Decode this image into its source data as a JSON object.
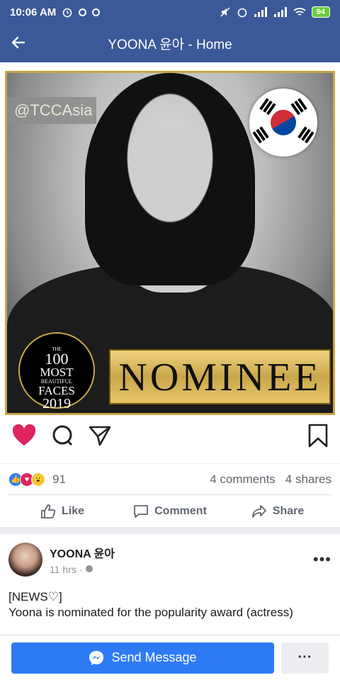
{
  "status": {
    "time": "10:06 AM",
    "battery": "94"
  },
  "header": {
    "title": "YOONA 윤아 - Home"
  },
  "post1": {
    "watermark": "@TCCAsia",
    "badge": {
      "the": "THE",
      "n100": "100",
      "most": "MOST",
      "beautiful": "BEAUTIFUL",
      "faces": "FACES",
      "year": "2019"
    },
    "banner": "NOMINEE",
    "reaction_count": "91",
    "comments": "4 comments",
    "shares": "4 shares",
    "buttons": {
      "like": "Like",
      "comment": "Comment",
      "share": "Share"
    }
  },
  "post2": {
    "author": "YOONA 윤아",
    "time": "11 hrs ·",
    "line1": "[NEWS♡]",
    "line2": "Yoona is nominated for the popularity award (actress)"
  },
  "bottom": {
    "send_label": "Send Message",
    "more_label": "···"
  },
  "colors": {
    "brand": "#3b5998",
    "send": "#2d7bf4",
    "heart": "#e0245e"
  }
}
